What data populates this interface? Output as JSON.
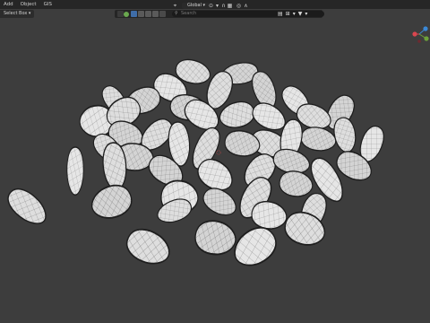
{
  "menubar": {
    "items": [
      "Add",
      "Object",
      "GIS"
    ]
  },
  "header": {
    "select_box_label": "Select Box",
    "global_label": "Global"
  },
  "search": {
    "placeholder": "Search"
  },
  "icons": {
    "transform_orientation": "orientation-icon",
    "pivot": "pivot-icon",
    "snap": "magnet-icon",
    "proportional": "proportional-edit-icon",
    "filter": "filter-icon",
    "list": "list-icon",
    "view": "view-icon",
    "gizmo": "navigation-gizmo"
  },
  "colors": {
    "axis_x": "#d9464f",
    "axis_y": "#6da13a",
    "axis_z": "#3a88d6",
    "active_button": "#3f6da8"
  }
}
